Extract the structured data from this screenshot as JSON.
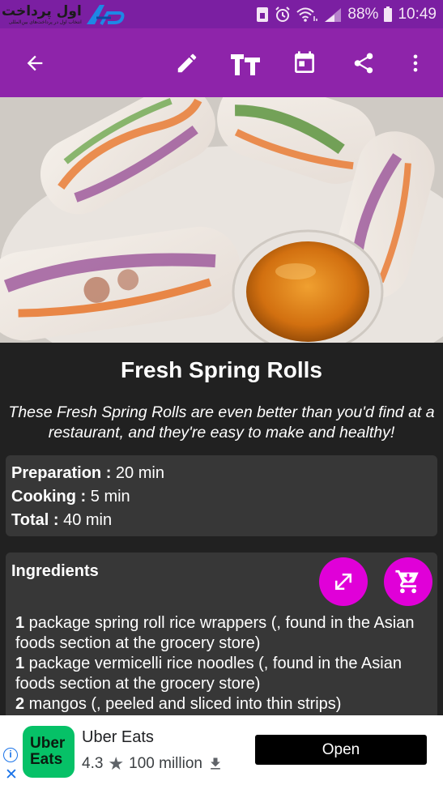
{
  "status_bar": {
    "logo_text": "اول پرداخت",
    "logo_tagline": "انتخاب اول در پرداخت‌های بین‌المللی",
    "battery": "88%",
    "time": "10:49"
  },
  "app_bar": {
    "icons": [
      "back-arrow-icon",
      "edit-icon",
      "text-size-icon",
      "calendar-icon",
      "share-icon",
      "more-vert-icon"
    ]
  },
  "recipe": {
    "title": "Fresh Spring Rolls",
    "description": "These Fresh Spring Rolls are even better than you'd find at a restaurant, and they're easy to make and healthy!",
    "times": [
      {
        "label": "Preparation :",
        "value": " 20 min"
      },
      {
        "label": "Cooking :",
        "value": " 5 min"
      },
      {
        "label": "Total :",
        "value": " 40 min"
      }
    ],
    "ingredients_heading": "Ingredients",
    "ingredients": [
      {
        "qty": "1",
        "text": " package spring roll rice wrappers (, found in the Asian foods section at the grocery store)"
      },
      {
        "qty": "1",
        "text": " package vermicelli rice noodles (, found in the Asian foods section at the grocery store)"
      },
      {
        "qty": "2",
        "text": " mangos (, peeled and sliced into thin strips)"
      }
    ]
  },
  "ad": {
    "info_symbol": "i",
    "close_symbol": "✕",
    "icon_line1": "Uber",
    "icon_line2": "Eats",
    "app_name": "Uber Eats",
    "rating": "4.3",
    "star": "★",
    "downloads": "100 million",
    "button": "Open"
  },
  "colors": {
    "status_bar": "#7b1fa2",
    "app_bar": "#8e24aa",
    "fab": "#e000d8",
    "background": "#212121",
    "card": "#373737"
  }
}
